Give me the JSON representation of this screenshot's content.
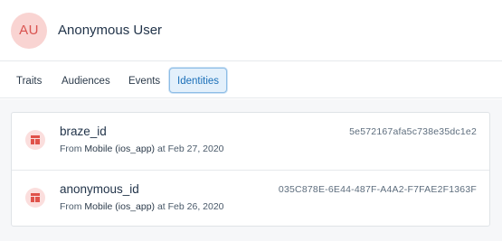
{
  "profile": {
    "avatar_initials": "AU",
    "name": "Anonymous User"
  },
  "tabs": [
    {
      "label": "Traits",
      "active": false
    },
    {
      "label": "Audiences",
      "active": false
    },
    {
      "label": "Events",
      "active": false
    },
    {
      "label": "Identities",
      "active": true
    }
  ],
  "identities": [
    {
      "icon": "table-icon",
      "key": "braze_id",
      "from_prefix": "From",
      "source": "Mobile (ios_app)",
      "date_text": "at Feb 27, 2020",
      "value": "5e572167afa5c738e35dc1e2"
    },
    {
      "icon": "table-icon",
      "key": "anonymous_id",
      "from_prefix": "From",
      "source": "Mobile (ios_app)",
      "date_text": "at Feb 26, 2020",
      "value": "035C878E-6E44-487F-A4A2-F7FAE2F1363F"
    }
  ],
  "colors": {
    "accent": "#1a6fb8",
    "avatar_bg": "#f9d4d2",
    "icon_red": "#e0524a"
  }
}
